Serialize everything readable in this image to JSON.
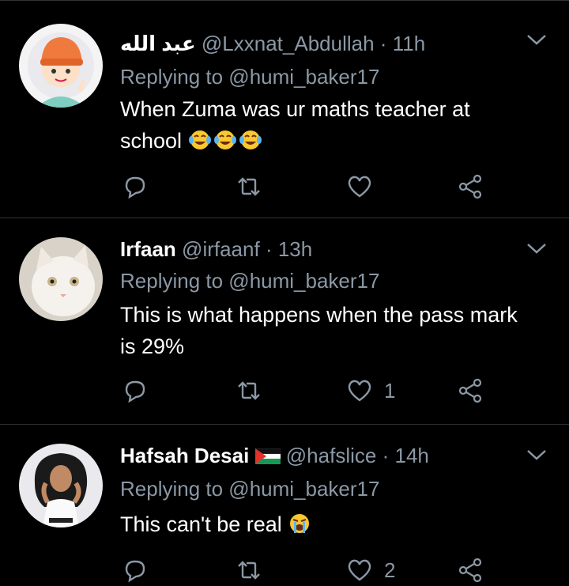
{
  "tweets": [
    {
      "display_name": "عبد الله",
      "handle": "@Lxxnat_Abdullah",
      "separator": "·",
      "time": "11h",
      "replying_to": "Replying to @humi_baker17",
      "text": "When Zuma was ur maths teacher at school",
      "emojis": [
        "face-with-tears-of-joy",
        "face-with-tears-of-joy",
        "face-with-tears-of-joy"
      ],
      "likes": "",
      "avatar": "cartoon-boy-orange-beanie"
    },
    {
      "display_name": "Irfaan",
      "handle": "@irfaanf",
      "separator": "·",
      "time": "13h",
      "replying_to": "Replying to @humi_baker17",
      "text": "This is what happens when the pass mark is 29%",
      "emojis": [],
      "likes": "1",
      "avatar": "white-cat"
    },
    {
      "display_name": "Hafsah Desai",
      "flag": "palestine-flag",
      "handle": "@hafslice",
      "separator": "·",
      "time": "14h",
      "replying_to": "Replying to @humi_baker17",
      "text": "This can't be real",
      "emojis": [
        "loudly-crying-face"
      ],
      "likes": "2",
      "avatar": "illustrated-woman-curly-hair"
    }
  ],
  "colors": {
    "background": "#000000",
    "muted": "#8b98a5",
    "divider": "#2f3336",
    "text": "#ffffff"
  }
}
